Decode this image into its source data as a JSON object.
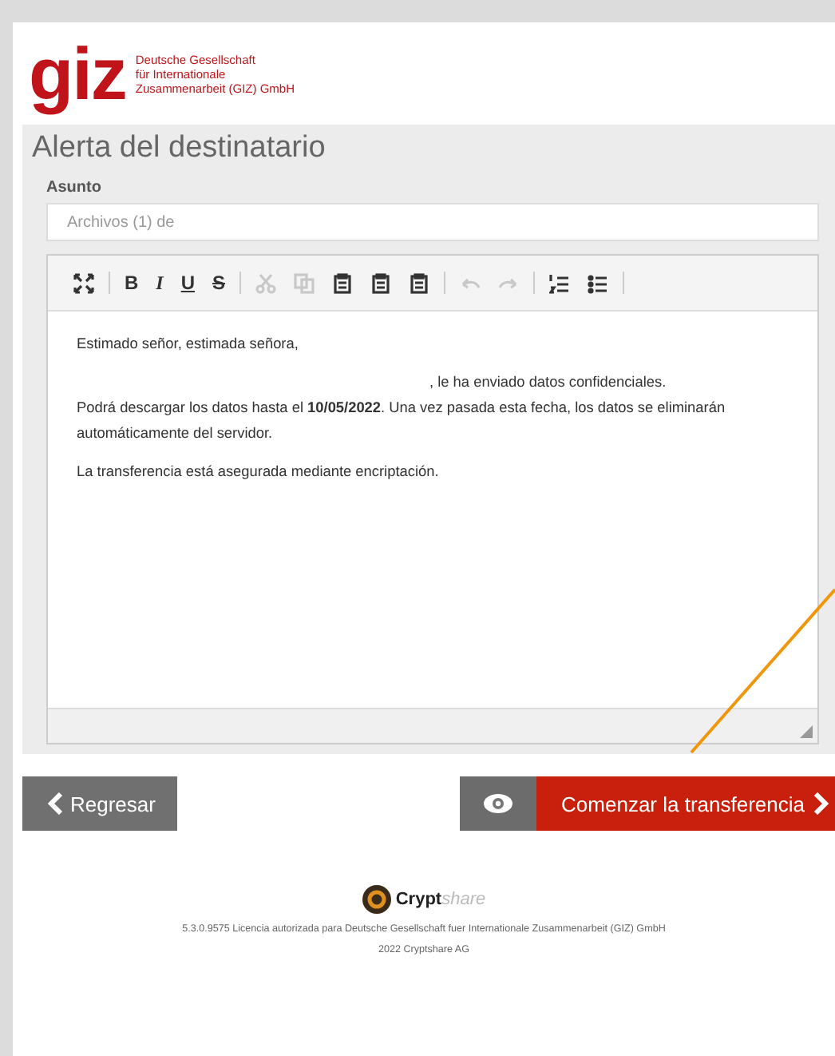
{
  "logo": {
    "mark": "giz",
    "lines": [
      "Deutsche Gesellschaft",
      "für Internationale",
      "Zusammenarbeit (GIZ) GmbH"
    ]
  },
  "title": "Alerta del destinatario",
  "subject": {
    "label": "Asunto",
    "placeholder": "Archivos (1) de"
  },
  "toolbar": [
    {
      "kind": "fullscreen",
      "disabled": false
    },
    {
      "kind": "separator"
    },
    {
      "kind": "bold",
      "label": "B",
      "disabled": false
    },
    {
      "kind": "italic",
      "label": "I",
      "disabled": false
    },
    {
      "kind": "underline",
      "label": "U",
      "disabled": false
    },
    {
      "kind": "strike",
      "label": "S",
      "disabled": false
    },
    {
      "kind": "separator"
    },
    {
      "kind": "cut",
      "disabled": true
    },
    {
      "kind": "copy",
      "disabled": true
    },
    {
      "kind": "paste",
      "disabled": false
    },
    {
      "kind": "paste",
      "disabled": false
    },
    {
      "kind": "paste",
      "disabled": false
    },
    {
      "kind": "separator"
    },
    {
      "kind": "undo",
      "disabled": true
    },
    {
      "kind": "redo",
      "disabled": true
    },
    {
      "kind": "separator"
    },
    {
      "kind": "ol",
      "disabled": false
    },
    {
      "kind": "ul",
      "disabled": false
    },
    {
      "kind": "separator"
    }
  ],
  "message": [
    {
      "text": "Estimado señor, estimada señora,",
      "kind": "paragraph"
    },
    {
      "text": ", le ha enviado datos confidenciales.",
      "kind": "continuation"
    },
    {
      "text": "Podrá descargar los datos hasta el **10/05/2022**. Una vez pasada esta fecha, los datos se eliminarán automáticamente del servidor.",
      "kind": "paragraph"
    },
    {
      "text": "La transferencia está asegurada mediante encriptación.",
      "kind": "paragraph"
    }
  ],
  "buttons": {
    "back": "Regresar",
    "start": "Comenzar la transferencia"
  },
  "footer": {
    "brand_bold": "Crypt",
    "brand_light": "share",
    "license": "5.3.0.9575 Licencia autorizada para Deutsche Gesellschaft fuer Internationale Zusammenarbeit (GIZ) GmbH",
    "copyright": "2022 Cryptshare AG"
  }
}
